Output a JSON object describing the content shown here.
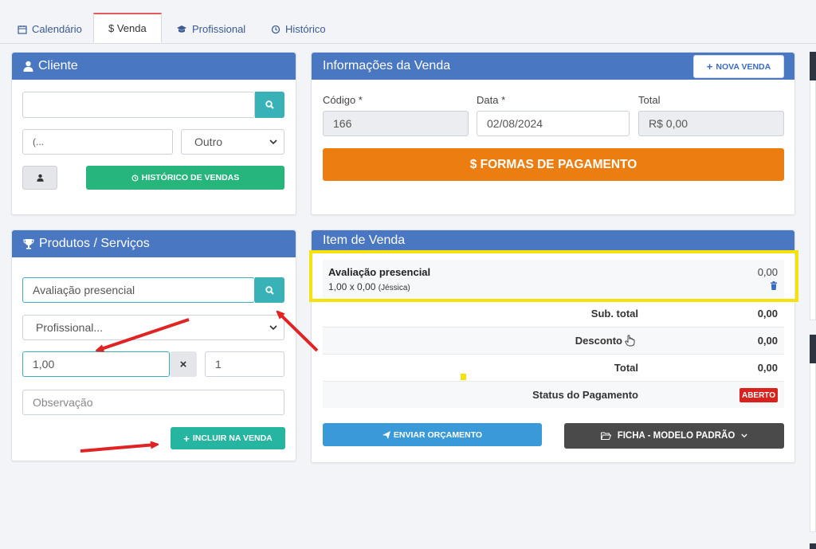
{
  "tabs": [
    {
      "label": "Calendário",
      "icon": "calendar-icon"
    },
    {
      "label": "$ Venda",
      "icon": "dollar-icon"
    },
    {
      "label": "Profissional",
      "icon": "graduation-cap-icon"
    },
    {
      "label": "Histórico",
      "icon": "history-icon"
    }
  ],
  "cliente": {
    "title": "Cliente",
    "name_value": "",
    "phone_value": "(...",
    "select_value": "Outro",
    "historico_label": "HISTÓRICO DE VENDAS"
  },
  "venda": {
    "title": "Informações da Venda",
    "nova_label": "NOVA VENDA",
    "codigo_label": "Código *",
    "codigo_value": "166",
    "data_label": "Data *",
    "data_value": "02/08/2024",
    "total_label": "Total",
    "total_value": "R$ 0,00",
    "pagamento_label": "$ FORMAS DE PAGAMENTO"
  },
  "produtos": {
    "title": "Produtos / Serviços",
    "product_value": "Avaliação presencial",
    "profissional_placeholder": "Profissional...",
    "qty_value": "1,00",
    "times_symbol": "×",
    "mult_value": "1",
    "obs_placeholder": "Observação",
    "incluir_label": "INCLUIR NA VENDA"
  },
  "item": {
    "title": "Item de Venda",
    "name": "Avaliação presencial",
    "detail": "1,00 x 0,00",
    "professional": "(Jéssica)",
    "price": "0,00",
    "subtotal_label": "Sub. total",
    "subtotal_value": "0,00",
    "desconto_label": "Desconto",
    "desconto_value": "0,00",
    "total_label": "Total",
    "total_value": "0,00",
    "status_label": "Status do Pagamento",
    "status_value": "ABERTO",
    "enviar_label": "ENVIAR ORÇAMENTO",
    "ficha_label": "FICHA - MODELO PADRÃO"
  },
  "colors": {
    "header_blue": "#4a77c2",
    "teal": "#38b2b6",
    "green": "#26b57a",
    "orange": "#ec7d10",
    "button_blue": "#3a9ad9",
    "dark_gray": "#4a4a4a",
    "status_red": "#d9211e",
    "highlight_yellow": "#f5e20a",
    "arrow_red": "#e02424"
  }
}
